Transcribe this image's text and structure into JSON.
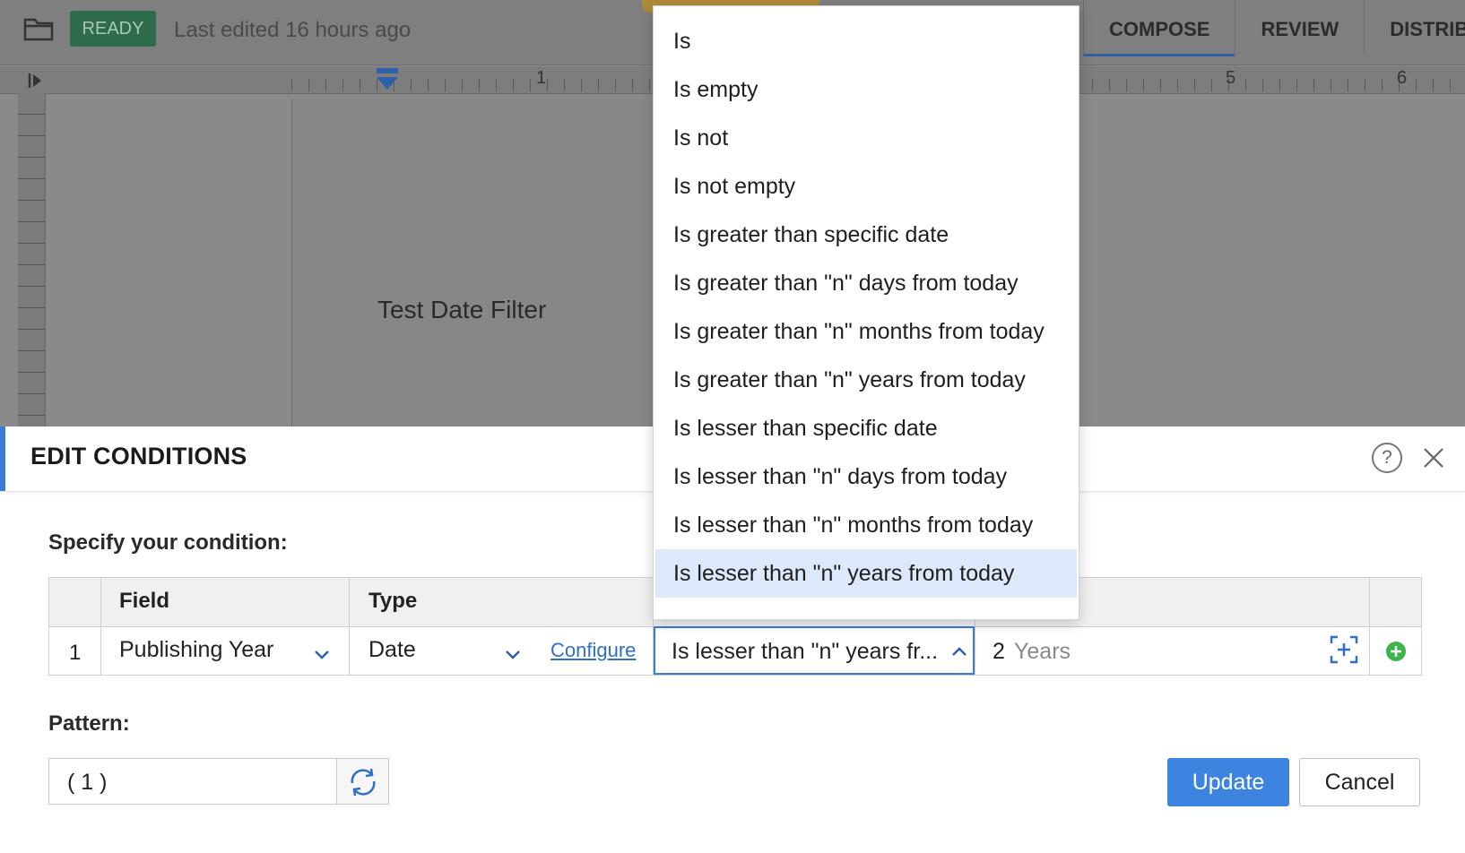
{
  "topbar": {
    "status_badge": "READY",
    "last_edited": "Last edited 16 hours ago",
    "tabs": [
      "COMPOSE",
      "REVIEW",
      "DISTRIBU"
    ],
    "active_tab": "COMPOSE"
  },
  "ruler": {
    "numbers": [
      "1",
      "5",
      "6"
    ]
  },
  "document": {
    "text": "Test Date Filter"
  },
  "dialog": {
    "title": "EDIT CONDITIONS",
    "specify_label": "Specify your condition:",
    "table": {
      "headers": {
        "field": "Field",
        "type": "Type"
      },
      "row": {
        "index": "1",
        "field": "Publishing Year",
        "type": "Date",
        "configure_link": "Configure",
        "operator": "Is lesser than \"n\" years fr...",
        "value_number": "2",
        "value_unit": "Years"
      }
    },
    "pattern_label": "Pattern:",
    "pattern_value": "( 1 )",
    "update_button": "Update",
    "cancel_button": "Cancel"
  },
  "operator_dropdown": {
    "options": [
      "Is",
      "Is empty",
      "Is not",
      "Is not empty",
      "Is greater than specific date",
      "Is greater than \"n\" days from today",
      "Is greater than \"n\" months from today",
      "Is greater than \"n\" years from today",
      "Is lesser than specific date",
      "Is lesser than \"n\" days from today",
      "Is lesser than \"n\" months from today",
      "Is lesser than \"n\" years from today"
    ],
    "selected": "Is lesser than \"n\" years from today"
  },
  "colors": {
    "accent": "#3a7bd5",
    "update_button": "#3d84e0",
    "selected_option": "#dde9fb",
    "add_icon": "#3cb44b",
    "ready_badge": "#2e6b4f"
  },
  "icons": [
    "folder-icon",
    "help-icon",
    "close-icon",
    "chevron-down-icon",
    "chevron-up-icon",
    "insert-field-icon",
    "add-condition-icon",
    "refresh-icon",
    "indent-marker-icon"
  ]
}
